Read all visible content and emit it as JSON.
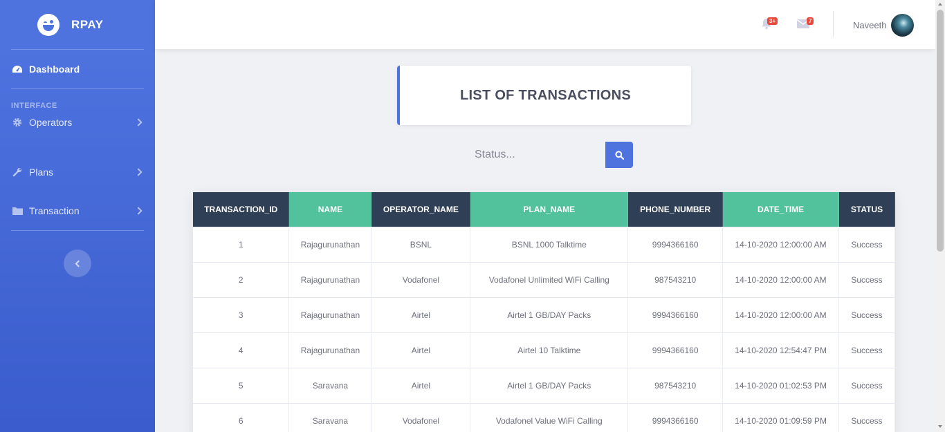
{
  "brand": {
    "name": "RPAY"
  },
  "sidebar": {
    "dashboard": "Dashboard",
    "heading": "INTERFACE",
    "items": [
      {
        "label": "Operators",
        "icon": "cog-icon"
      },
      {
        "label": "Plans",
        "icon": "wrench-icon"
      },
      {
        "label": "Transaction",
        "icon": "folder-icon"
      }
    ]
  },
  "topbar": {
    "alerts_badge": "3+",
    "messages_badge": "7",
    "username": "Naveeth"
  },
  "page": {
    "title": "LIST OF TRANSACTIONS"
  },
  "search": {
    "placeholder": "Status..."
  },
  "table": {
    "headers": [
      "TRANSACTION_ID",
      "NAME",
      "OPERATOR_NAME",
      "PLAN_NAME",
      "PHONE_NUMBER",
      "DATE_TIME",
      "STATUS"
    ],
    "rows": [
      [
        "1",
        "Rajagurunathan",
        "BSNL",
        "BSNL 1000 Talktime",
        "9994366160",
        "14-10-2020 12:00:00 AM",
        "Success"
      ],
      [
        "2",
        "Rajagurunathan",
        "Vodafonel",
        "Vodafonel Unlimited WiFi Calling",
        "987543210",
        "14-10-2020 12:00:00 AM",
        "Success"
      ],
      [
        "3",
        "Rajagurunathan",
        "Airtel",
        "Airtel 1 GB/DAY Packs",
        "9994366160",
        "14-10-2020 12:00:00 AM",
        "Success"
      ],
      [
        "4",
        "Rajagurunathan",
        "Airtel",
        "Airtel 10 Talktime",
        "9994366160",
        "14-10-2020 12:54:47 PM",
        "Success"
      ],
      [
        "5",
        "Saravana",
        "Airtel",
        "Airtel 1 GB/DAY Packs",
        "987543210",
        "14-10-2020 01:02:53 PM",
        "Success"
      ],
      [
        "6",
        "Saravana",
        "Vodafonel",
        "Vodafonel Value WiFi Calling",
        "9994366160",
        "14-10-2020 01:09:59 PM",
        "Success"
      ]
    ]
  },
  "colors": {
    "primary": "#4e73df",
    "header_dark": "#2f3f56",
    "header_green": "#52c29d",
    "badge": "#e74a3b"
  }
}
